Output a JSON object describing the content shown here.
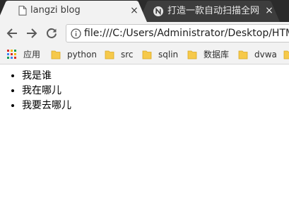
{
  "tabs": [
    {
      "title": "langzi blog",
      "close": "×",
      "active": true,
      "favicon": "document-icon"
    },
    {
      "title": "打造一款自动扫描全网漏",
      "close": "×",
      "active": false,
      "favicon": "n-logo-icon"
    }
  ],
  "toolbar": {
    "back_icon": "arrow-left-icon",
    "forward_icon": "arrow-right-icon",
    "reload_icon": "reload-icon",
    "url": "file:///C:/Users/Administrator/Desktop/HTM"
  },
  "bookmarks": [
    {
      "label": "应用",
      "icon": "apps-grid-icon"
    },
    {
      "label": "python",
      "icon": "folder-icon"
    },
    {
      "label": "src",
      "icon": "folder-icon"
    },
    {
      "label": "sqlin",
      "icon": "folder-icon"
    },
    {
      "label": "数据库",
      "icon": "folder-icon"
    },
    {
      "label": "dvwa",
      "icon": "folder-icon"
    }
  ],
  "content": {
    "items": [
      "我是谁",
      "我在哪儿",
      "我要去哪儿"
    ]
  },
  "colors": {
    "tabstrip_dark": "#2b2b2b",
    "tab_active": "#f2f2f2",
    "tab_inactive": "#3d3d3d",
    "folder_yellow": "#f6c94a"
  }
}
